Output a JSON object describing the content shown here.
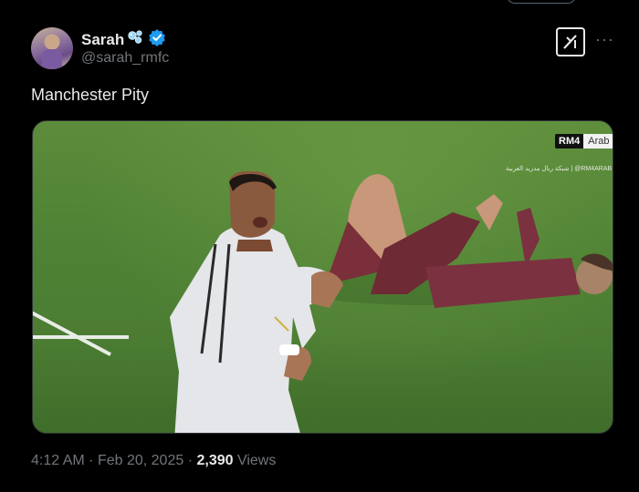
{
  "tweet": {
    "display_name": "Sarah",
    "handle": "@sarah_rmfc",
    "text": "Manchester Pity",
    "time": "4:12 AM",
    "date": "Feb 20, 2025",
    "separator": "·",
    "views_count": "2,390",
    "views_label": "Views"
  },
  "media": {
    "watermark_brand": "RM4",
    "watermark_word": "Arab",
    "watermark_caption": "شبكة ريال مدريد العربية | @RM4ARAB"
  },
  "icons": {
    "avatar": "avatar",
    "name_emoji": "bubbles-icon",
    "verified": "verified-badge-icon",
    "grok": "grok-icon",
    "more": "more-icon"
  },
  "colors": {
    "background": "#000000",
    "text": "#e7e9ea",
    "secondary": "#71767b",
    "verified": "#1d9bf0",
    "border": "#2f3336"
  }
}
